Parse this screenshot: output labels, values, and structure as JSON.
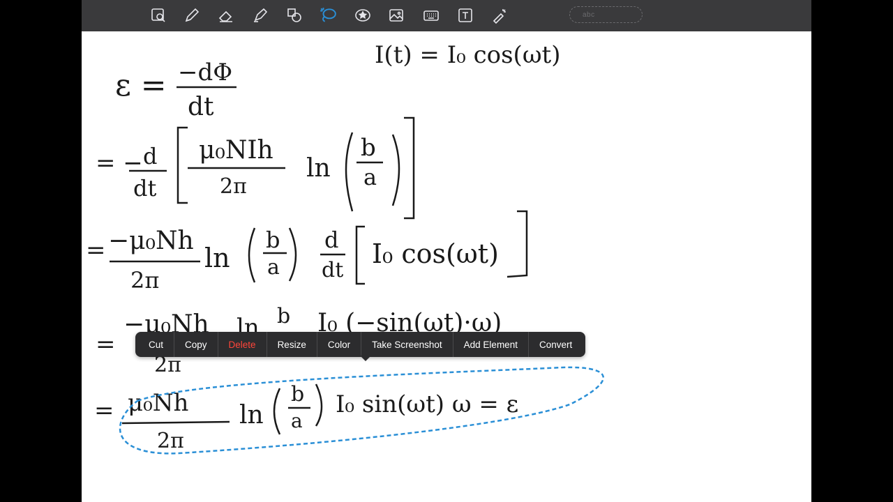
{
  "toolbar": {
    "tools": [
      {
        "icon": "zoom-box-icon"
      },
      {
        "icon": "pen-icon"
      },
      {
        "icon": "eraser-icon"
      },
      {
        "icon": "highlighter-icon"
      },
      {
        "icon": "shapes-icon"
      },
      {
        "icon": "lasso-icon",
        "active": true
      },
      {
        "icon": "sticker-icon"
      },
      {
        "icon": "image-icon"
      },
      {
        "icon": "keyboard-icon"
      },
      {
        "icon": "text-box-icon"
      },
      {
        "icon": "laser-pointer-icon"
      }
    ],
    "shape_preview_text": "abc"
  },
  "colors": {
    "toolbar_bg": "#3a3a3c",
    "canvas_bg": "#ffffff",
    "ink": "#1a1a1a",
    "lasso_selection": "#2a8fd6",
    "menu_bg": "#2c2c2e",
    "delete_text": "#ff453a"
  },
  "context_menu": {
    "items": [
      {
        "label": "Cut"
      },
      {
        "label": "Copy"
      },
      {
        "label": "Delete",
        "destructive": true
      },
      {
        "label": "Resize"
      },
      {
        "label": "Color"
      },
      {
        "label": "Take Screenshot"
      },
      {
        "label": "Add Element"
      },
      {
        "label": "Convert"
      }
    ]
  },
  "handwriting": {
    "current_eq": "I(t) = I₀ cos(ωt)",
    "line1": {
      "lhs": "ε =",
      "num": "−dΦ",
      "den": "dt"
    },
    "line2": {
      "prefix": "= −",
      "d_num": "d",
      "d_den": "dt",
      "num": "μ₀NIh",
      "den": "2π",
      "ln": "ln",
      "frac_num": "b",
      "frac_den": "a"
    },
    "line3": {
      "prefix": "=",
      "num": "−μ₀Nh",
      "den": "2π",
      "ln": "ln",
      "frac_num": "b",
      "frac_den": "a",
      "d_num": "d",
      "d_den": "dt",
      "bracket": "I₀ cos(ωt)"
    },
    "line4": {
      "prefix": "=",
      "num": "−μ₀Nh",
      "den": "2π",
      "ln": "ln",
      "frac_num": "b",
      "frac_den": "a",
      "rest": "I₀ (−sin(ωt)·ω)"
    },
    "line5": {
      "prefix": "=",
      "num": "μ₀Nh",
      "den": "2π",
      "ln": "ln",
      "frac_num": "b",
      "frac_den": "a",
      "rest": "I₀ sin(ωt) ω = ε"
    }
  }
}
